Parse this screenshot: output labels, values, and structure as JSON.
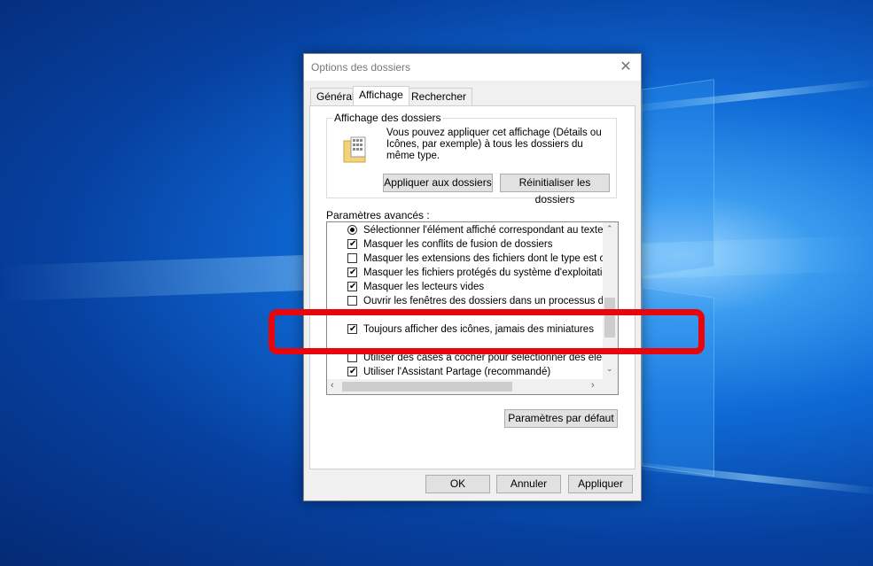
{
  "window": {
    "title": "Options des dossiers",
    "close_glyph": "✕"
  },
  "tabs": [
    {
      "label": "Général",
      "active": false
    },
    {
      "label": "Affichage",
      "active": true
    },
    {
      "label": "Rechercher",
      "active": false
    }
  ],
  "folder_views": {
    "legend": "Affichage des dossiers",
    "description": "Vous pouvez appliquer cet affichage (Détails ou Icônes, par exemple) à tous les dossiers du même type.",
    "apply_button": "Appliquer aux dossiers",
    "reset_button": "Réinitialiser les dossiers",
    "icon": "folder-grid-icon"
  },
  "advanced": {
    "label": "Paramètres avancés :",
    "items": [
      {
        "type": "radio",
        "checked": true,
        "label": "Sélectionner l'élément affiché correspondant au texte"
      },
      {
        "type": "checkbox",
        "checked": true,
        "label": "Masquer les conflits de fusion de dossiers"
      },
      {
        "type": "checkbox",
        "checked": false,
        "label": "Masquer les extensions des fichiers dont le type est connu"
      },
      {
        "type": "checkbox",
        "checked": true,
        "label": "Masquer les fichiers protégés du système d'exploitation (recommandé)"
      },
      {
        "type": "checkbox",
        "checked": true,
        "label": "Masquer les lecteurs vides"
      },
      {
        "type": "checkbox",
        "checked": false,
        "label": "Ouvrir les fenêtres des dossiers dans un processus différent"
      },
      {
        "type": "checkbox",
        "checked": true,
        "label": "Toujours afficher des icônes, jamais des miniatures"
      },
      {
        "type": "checkbox",
        "checked": false,
        "label": "Utiliser des cases à cocher pour sélectionner des éléments"
      },
      {
        "type": "checkbox",
        "checked": true,
        "label": "Utiliser l'Assistant Partage (recommandé)"
      }
    ],
    "defaults_button": "Paramètres par défaut"
  },
  "footer": {
    "ok": "OK",
    "cancel": "Annuler",
    "apply": "Appliquer"
  },
  "colors": {
    "highlight": "#e8050b",
    "desktop_blue": "#0f6ad6"
  }
}
